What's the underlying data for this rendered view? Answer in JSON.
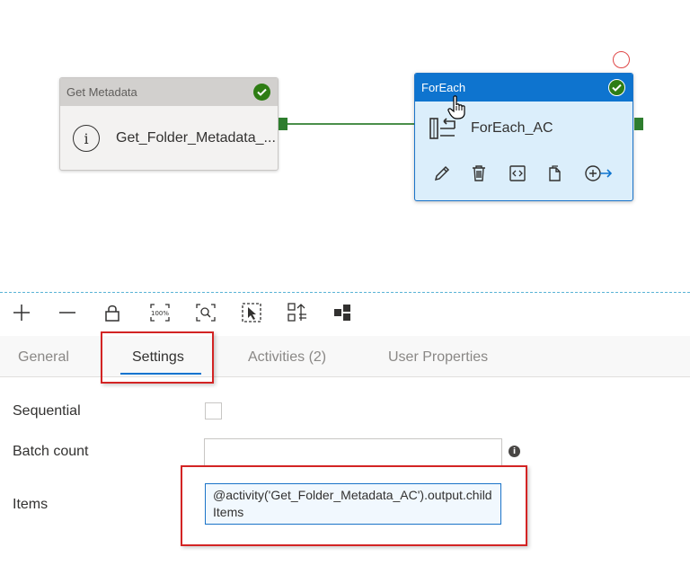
{
  "canvas": {
    "get_metadata": {
      "header": "Get Metadata",
      "name": "Get_Folder_Metadata_..."
    },
    "foreach": {
      "header": "ForEach",
      "name": "ForEach_AC"
    }
  },
  "toolbar": {
    "icons": [
      "plus-icon",
      "minus-icon",
      "lock-icon",
      "zoom-100-icon",
      "zoom-fit-icon",
      "select-icon",
      "auto-align-icon",
      "layout-icon"
    ]
  },
  "tabs": [
    {
      "label": "General"
    },
    {
      "label": "Settings"
    },
    {
      "label": "Activities (2)"
    },
    {
      "label": "User Properties"
    }
  ],
  "settings": {
    "sequential_label": "Sequential",
    "batch_count_label": "Batch count",
    "batch_count_value": "",
    "items_label": "Items",
    "items_value": "@activity('Get_Folder_Metadata_AC').output.childItems"
  },
  "colors": {
    "accent": "#0e74cf",
    "success": "#2e7d14",
    "highlight": "#d32424"
  }
}
